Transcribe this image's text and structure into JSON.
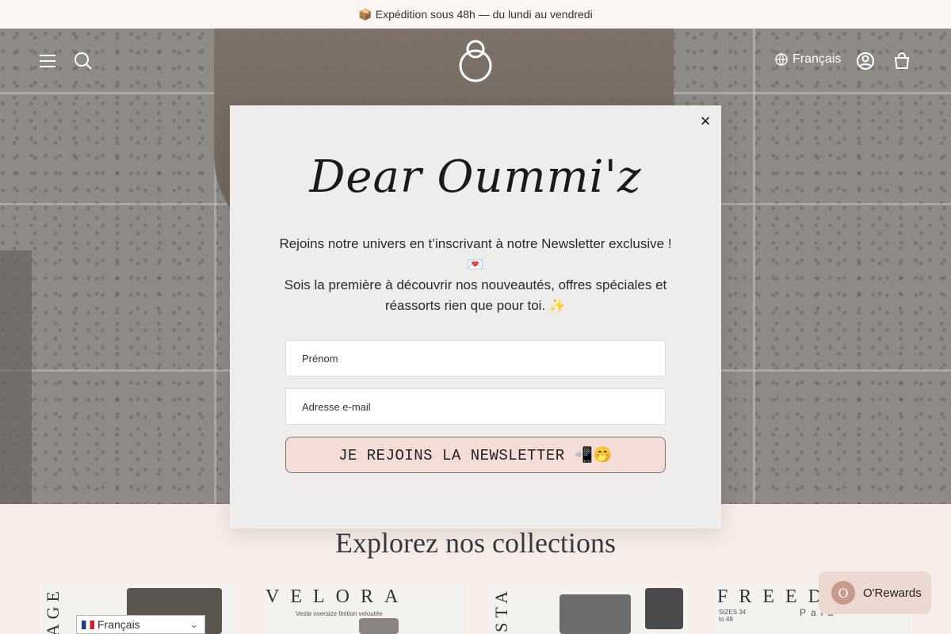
{
  "announcement": {
    "icon": "📦",
    "text": "Expédition sous 48h — du lundi au vendredi"
  },
  "header": {
    "menu_icon": "menu-icon",
    "search_icon": "search-icon",
    "logo_text": "O",
    "language_label": "Français",
    "account_icon": "account-icon",
    "cart_icon": "cart-icon"
  },
  "popup": {
    "title": "Dear Oummi'z",
    "line1": "Rejoins notre univers en t’inscrivant à notre Newsletter exclusive !",
    "line1_emoji": "💌",
    "line2": "Sois la première à découvrir nos nouveautés, offres spéciales et réassorts rien que pour toi. ✨",
    "first_name_placeholder": "Prénom",
    "email_placeholder": "Adresse e-mail",
    "submit_label": "JE REJOINS LA NEWSLETTER 📲🤭",
    "close_glyph": "×"
  },
  "collections": {
    "title": "Explorez nos collections",
    "cards": [
      {
        "label": "TAGE"
      },
      {
        "label": "VELORA",
        "subtitle": "Veste oversize finition veloutée"
      },
      {
        "label": "STA"
      },
      {
        "label": "FREEDO",
        "subtitle": "Pala",
        "sizes": "SIZES 34 to 48"
      }
    ]
  },
  "language_selector": {
    "label": "Français"
  },
  "rewards_button": {
    "label": "O'Rewards"
  },
  "colors": {
    "accent": "#f3ddd6",
    "page_bg": "#f7ece8",
    "modal_bg": "#eeedeb"
  }
}
